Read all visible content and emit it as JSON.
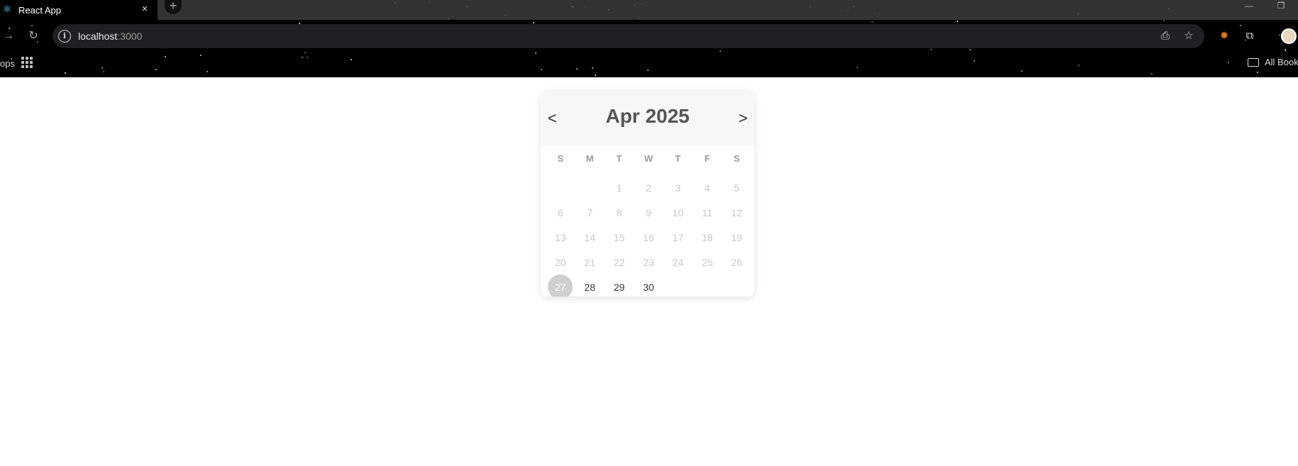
{
  "browser": {
    "tab_title": "React App",
    "tab_close_glyph": "×",
    "new_tab_glyph": "+",
    "url_host": "localhost",
    "url_port": ":3000",
    "bookmarks_apps_label": "ops",
    "all_bookmarks_label": "All Bookm"
  },
  "calendar": {
    "prev_label": "<",
    "next_label": ">",
    "title": "Apr 2025",
    "weekdays": [
      "S",
      "M",
      "T",
      "W",
      "T",
      "F",
      "S"
    ],
    "weeks": [
      [
        {
          "label": "",
          "state": "empty"
        },
        {
          "label": "",
          "state": "empty"
        },
        {
          "label": "1",
          "state": "disabled"
        },
        {
          "label": "2",
          "state": "disabled"
        },
        {
          "label": "3",
          "state": "disabled"
        },
        {
          "label": "4",
          "state": "disabled"
        },
        {
          "label": "5",
          "state": "disabled"
        }
      ],
      [
        {
          "label": "6",
          "state": "disabled"
        },
        {
          "label": "7",
          "state": "disabled"
        },
        {
          "label": "8",
          "state": "disabled"
        },
        {
          "label": "9",
          "state": "disabled"
        },
        {
          "label": "10",
          "state": "disabled"
        },
        {
          "label": "11",
          "state": "disabled"
        },
        {
          "label": "12",
          "state": "disabled"
        }
      ],
      [
        {
          "label": "13",
          "state": "disabled"
        },
        {
          "label": "14",
          "state": "disabled"
        },
        {
          "label": "15",
          "state": "disabled"
        },
        {
          "label": "16",
          "state": "disabled"
        },
        {
          "label": "17",
          "state": "disabled"
        },
        {
          "label": "18",
          "state": "disabled"
        },
        {
          "label": "19",
          "state": "disabled"
        }
      ],
      [
        {
          "label": "20",
          "state": "disabled"
        },
        {
          "label": "21",
          "state": "disabled"
        },
        {
          "label": "22",
          "state": "disabled"
        },
        {
          "label": "23",
          "state": "disabled"
        },
        {
          "label": "24",
          "state": "disabled"
        },
        {
          "label": "25",
          "state": "disabled"
        },
        {
          "label": "26",
          "state": "disabled"
        }
      ],
      [
        {
          "label": "27",
          "state": "today"
        },
        {
          "label": "28",
          "state": "active"
        },
        {
          "label": "29",
          "state": "active"
        },
        {
          "label": "30",
          "state": "active"
        },
        {
          "label": "",
          "state": "empty"
        },
        {
          "label": "",
          "state": "empty"
        },
        {
          "label": "",
          "state": "empty"
        }
      ]
    ]
  },
  "colors": {
    "chrome_bg": "#000000",
    "omnibox_bg": "#1f2024",
    "calendar_header_bg": "#f7f7f7",
    "disabled_day": "#c8c8c8",
    "active_day": "#333333",
    "today_circle": "#cfcfcf"
  },
  "icons": {
    "favicon": "react-logo-icon",
    "back": "back-arrow-icon",
    "forward": "forward-arrow-icon",
    "reload": "reload-icon",
    "site_info": "info-icon",
    "install": "install-app-icon",
    "bookmark": "star-icon",
    "extension_fox": "metamask-fox-icon",
    "extensions": "puzzle-icon",
    "profile": "avatar",
    "apps": "apps-grid-icon",
    "folder": "folder-icon"
  }
}
